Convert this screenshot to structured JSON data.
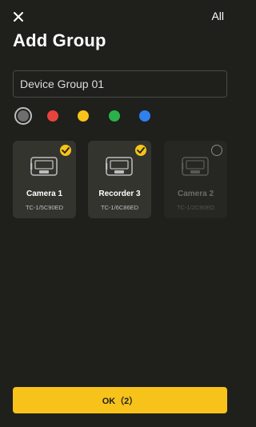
{
  "header": {
    "close_icon": "close-icon",
    "all_label": "All"
  },
  "title": "Add Group",
  "group_name_input": {
    "value": "Device Group 01"
  },
  "colors": {
    "selected": "#6e6e6e",
    "options": [
      "#6e6e6e",
      "#e8433d",
      "#f7c31a",
      "#29b24a",
      "#2f80ed"
    ]
  },
  "devices": [
    {
      "name": "Camera 1",
      "id": "TC-1/5C90ED",
      "state": "checked",
      "status_icon": "checkmark-icon"
    },
    {
      "name": "Recorder 3",
      "id": "TC-1/6C86ED",
      "state": "checked",
      "status_icon": "checkmark-icon"
    },
    {
      "name": "Camera 2",
      "id": "TC-1/2C90ED",
      "state": "disabled",
      "status_icon": "empty-circle-icon"
    }
  ],
  "ok_button": {
    "label": "OK（2）"
  },
  "accent_color": "#f7c31a"
}
